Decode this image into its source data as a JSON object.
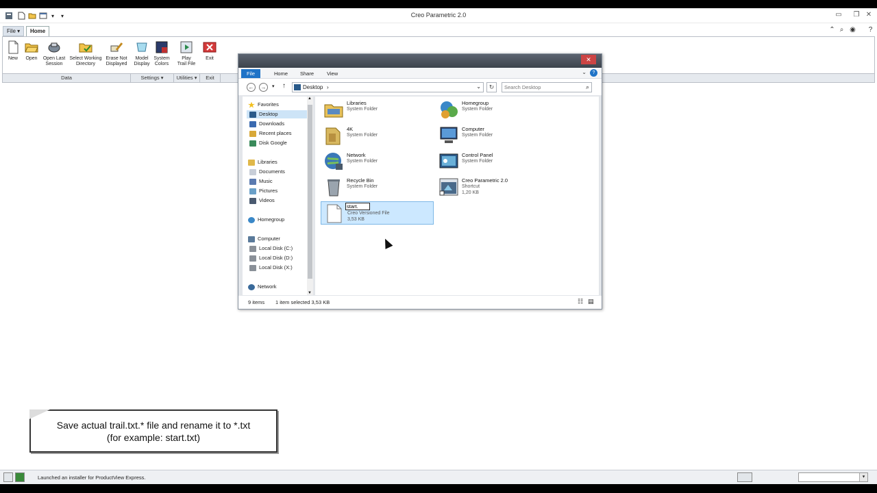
{
  "app": {
    "title": "Creo Parametric 2.0"
  },
  "ribbon": {
    "tabs": [
      {
        "label": "File ▾"
      },
      {
        "label": "Home"
      }
    ],
    "buttons": [
      {
        "label": "New"
      },
      {
        "label": "Open"
      },
      {
        "label": "Open Last\nSession"
      },
      {
        "label": "Select Working\nDirectory"
      },
      {
        "label": "Erase Not\nDisplayed"
      },
      {
        "label": "Model\nDisplay"
      },
      {
        "label": "System\nColors"
      },
      {
        "label": "Play\nTrail File"
      },
      {
        "label": "Exit"
      }
    ],
    "groups": [
      {
        "label": "Data"
      },
      {
        "label": "Settings ▾"
      },
      {
        "label": "Utilities ▾"
      },
      {
        "label": "Exit"
      }
    ]
  },
  "explorer": {
    "tabs": {
      "file": "File",
      "home": "Home",
      "share": "Share",
      "view": "View"
    },
    "address": {
      "location": "Desktop",
      "search_placeholder": "Search Desktop"
    },
    "nav": {
      "favorites": "Favorites",
      "desktop": "Desktop",
      "downloads": "Downloads",
      "recent": "Recent places",
      "disk_google": "Disk Google",
      "libraries": "Libraries",
      "documents": "Documents",
      "music": "Music",
      "pictures": "Pictures",
      "videos": "Videos",
      "homegroup": "Homegroup",
      "computer": "Computer",
      "disk_c": "Local Disk (C:)",
      "disk_d": "Local Disk (D:)",
      "disk_x": "Local Disk (X:)",
      "network": "Network"
    },
    "items": [
      {
        "name": "Libraries",
        "type": "System Folder",
        "icon": "libraries-icon"
      },
      {
        "name": "Homegroup",
        "type": "System Folder",
        "icon": "homegroup-icon"
      },
      {
        "name": "4K",
        "type": "System Folder",
        "icon": "user-folder-icon"
      },
      {
        "name": "Computer",
        "type": "System Folder",
        "icon": "computer-icon"
      },
      {
        "name": "Network",
        "type": "System Folder",
        "icon": "network-icon"
      },
      {
        "name": "Control Panel",
        "type": "System Folder",
        "icon": "control-panel-icon"
      },
      {
        "name": "Recycle Bin",
        "type": "System Folder",
        "icon": "recycle-bin-icon"
      },
      {
        "name": "Creo Parametric 2.0",
        "type": "Shortcut",
        "size": "1,20 KB",
        "icon": "creo-shortcut-icon"
      },
      {
        "name": "start.",
        "type": "Creo Versioned File",
        "size": "3,53 KB",
        "icon": "file-icon"
      }
    ],
    "status": {
      "count": "9 items",
      "selected": "1 item selected  3,53 KB"
    }
  },
  "callout": {
    "line1": "Save actual trail.txt.* file and rename it to *.txt",
    "line2": "(for example: start.txt)"
  },
  "statusbar": {
    "message": "Launched an installer for ProductView Express."
  },
  "colors": {
    "accent": "#1f73c7",
    "selection": "#cce8ff",
    "close": "#c44444"
  }
}
